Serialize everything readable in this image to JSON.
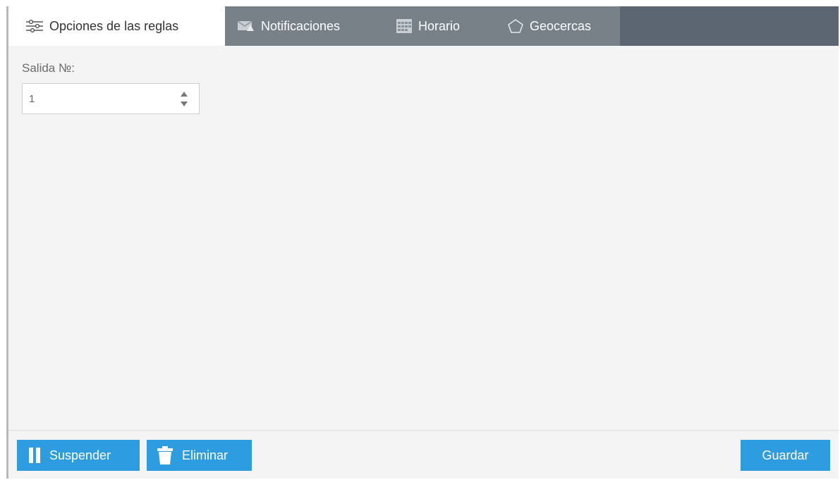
{
  "tabs": [
    {
      "label": "Opciones de las reglas",
      "icon": "sliders-icon",
      "active": true
    },
    {
      "label": "Notificaciones",
      "icon": "envelope-icon",
      "active": false
    },
    {
      "label": "Horario",
      "icon": "calendar-icon",
      "active": false
    },
    {
      "label": "Geocercas",
      "icon": "pentagon-icon",
      "active": false
    }
  ],
  "form": {
    "output_label": "Salida №:",
    "output_value": "1"
  },
  "footer": {
    "suspend_label": "Suspender",
    "delete_label": "Eliminar",
    "save_label": "Guardar"
  },
  "colors": {
    "accent": "#2d9ddf",
    "tabbar": "#5b6670",
    "tab_inactive": "#788188",
    "background": "#f4f4f4"
  }
}
